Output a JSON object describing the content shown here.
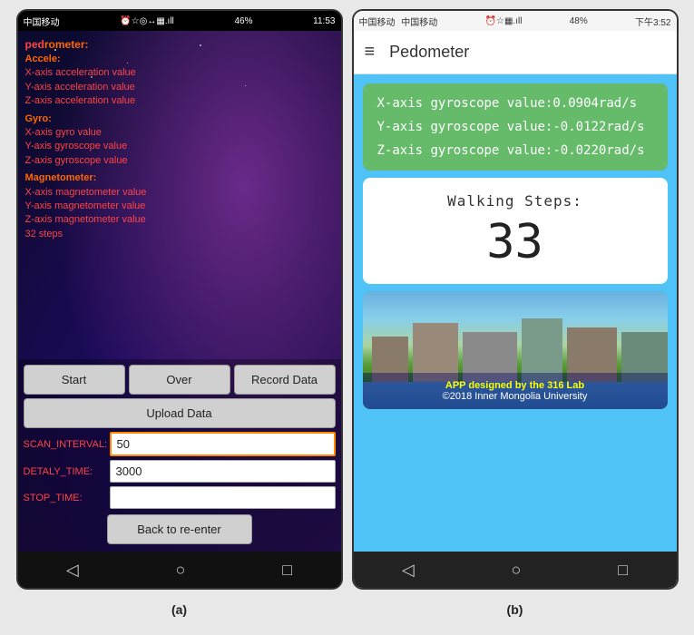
{
  "phoneA": {
    "statusBar": {
      "carrier": "中国移动",
      "time": "11:53",
      "battery": "46%",
      "icons": "⏰ ☆ ◎ ⌂ ↔ .all"
    },
    "title": "rometer:",
    "sensors": {
      "accelerometer": {
        "title": "Accele:",
        "values": [
          "X-axis acceleration value",
          "Y-axis acceleration value",
          "Z-axis acceleration value"
        ]
      },
      "gyro": {
        "title": "Gyro:",
        "values": [
          "X-axis gyro value",
          "Y-axis gyroscope value",
          "Z-axis gyroscope value"
        ]
      },
      "magnetometer": {
        "title": "Magnetometer:",
        "values": [
          "X-axis magnetometer value",
          "Y-axis magnetometer value",
          "Z-axis magnetometer value",
          "32 steps"
        ]
      }
    },
    "buttons": {
      "start": "Start",
      "over": "Over",
      "recordData": "Record Data",
      "uploadData": "Upload Data",
      "backToReEnter": "Back to re-enter"
    },
    "inputs": {
      "scanInterval": {
        "label": "SCAN_INTERVAL:",
        "value": "50"
      },
      "delayTime": {
        "label": "DETALY_TIME:",
        "value": "3000"
      },
      "stopTime": {
        "label": "STOP_TIME:",
        "value": ""
      }
    },
    "navIcons": [
      "◁",
      "○",
      "□"
    ]
  },
  "phoneB": {
    "statusBar": {
      "carrier": "中国移动",
      "carrier2": "中国移动",
      "time": "下午3:52",
      "battery": "48%"
    },
    "topBar": {
      "hamburger": "≡",
      "title": "Pedometer"
    },
    "gyroscope": {
      "xValue": "X-axis gyroscope value:0.0904rad/s",
      "yValue": "Y-axis gyroscope value:-0.0122rad/s",
      "zValue": "Z-axis gyroscope value:-0.0220rad/s"
    },
    "steps": {
      "label": "Walking Steps:",
      "value": "33"
    },
    "imageCard": {
      "text1": "APP designed by the 316 Lab",
      "text2": "©2018 Inner Mongolia University"
    },
    "navIcons": [
      "◁",
      "○",
      "□"
    ]
  },
  "captions": {
    "a": "(a)",
    "b": "(b)"
  }
}
